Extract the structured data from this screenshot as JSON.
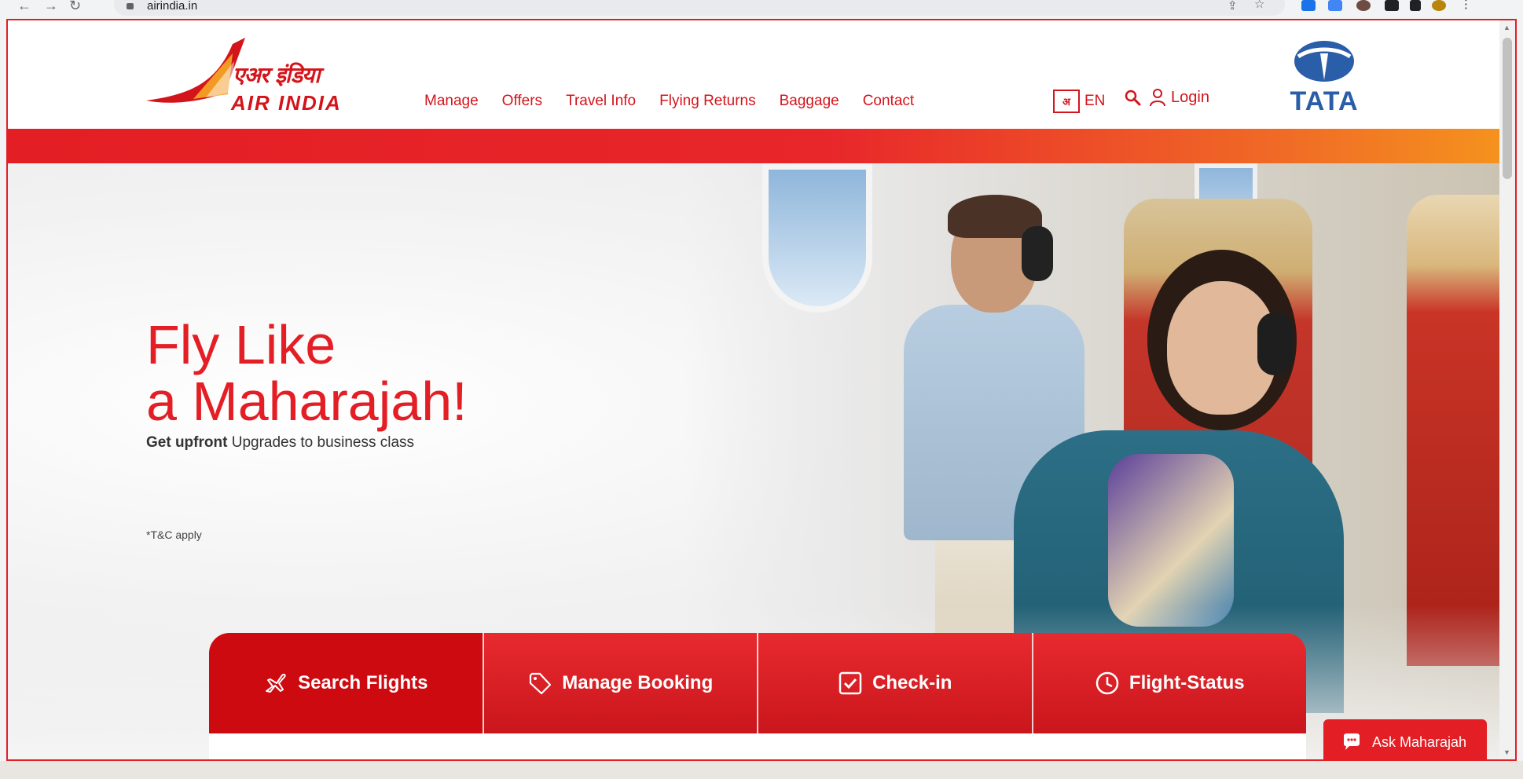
{
  "browser": {
    "url": "airindia.in"
  },
  "brand": {
    "logo_hindi": "एअर इंडिया",
    "logo_english": "AIR INDIA",
    "partner": "TATA",
    "colors": {
      "primary": "#e31e24",
      "accent": "#f5921e",
      "partner_blue": "#2a5ea9"
    }
  },
  "nav": {
    "items": [
      {
        "label": "Manage"
      },
      {
        "label": "Offers"
      },
      {
        "label": "Travel Info"
      },
      {
        "label": "Flying Returns"
      },
      {
        "label": "Baggage"
      },
      {
        "label": "Contact"
      }
    ],
    "language_icon": "अ",
    "language": "EN",
    "login": "Login"
  },
  "hero": {
    "title_line1": "Fly Like",
    "title_line2": "a Maharajah!",
    "subtitle_bold": "Get upfront",
    "subtitle_rest": " Upgrades to business class",
    "tnc": "*T&C apply"
  },
  "booking_tabs": [
    {
      "label": "Search Flights",
      "icon": "plane-icon"
    },
    {
      "label": "Manage Booking",
      "icon": "tag-icon"
    },
    {
      "label": "Check-in",
      "icon": "checkbox-icon"
    },
    {
      "label": "Flight-Status",
      "icon": "clock-icon"
    }
  ],
  "chat": {
    "label": "Ask Maharajah"
  }
}
